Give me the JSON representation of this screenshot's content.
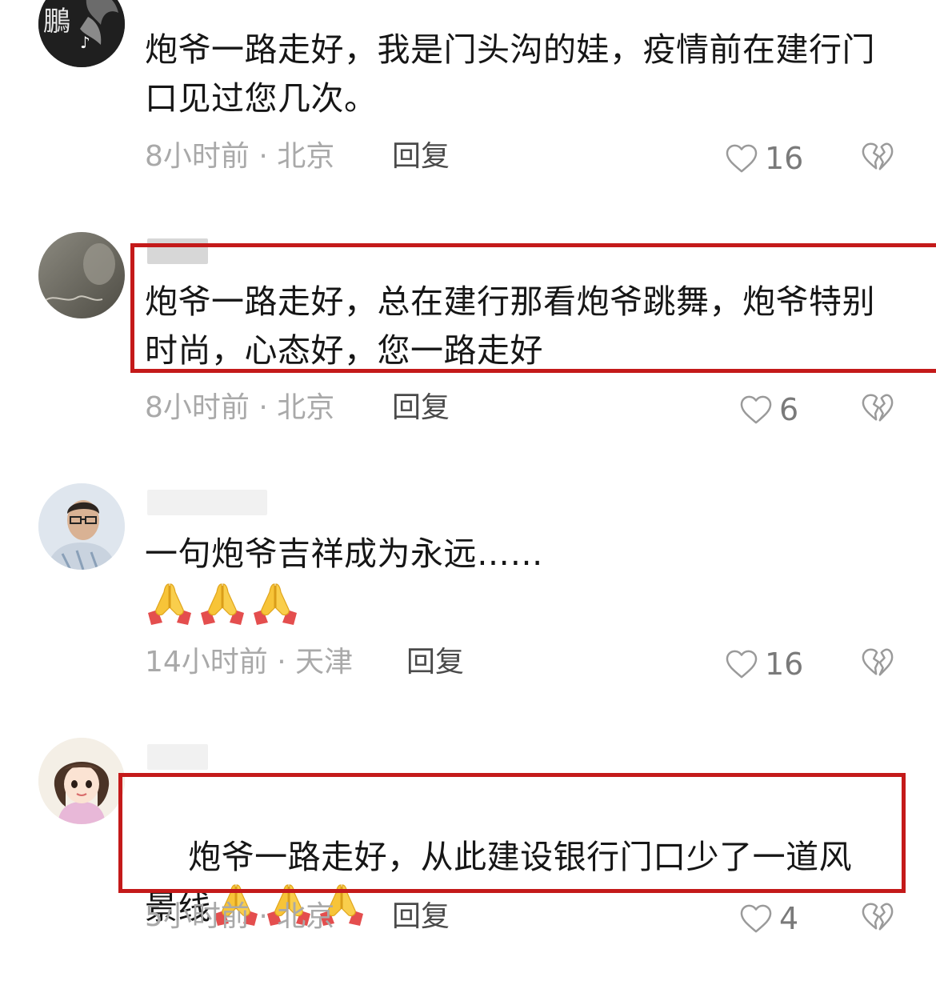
{
  "colors": {
    "highlight": "#c41a1a",
    "meta_text": "#a9a9a9",
    "reply_text": "#4a4a4a",
    "body_text": "#161616"
  },
  "comments": [
    {
      "avatar_icon": "avatar-dark-bird-icon",
      "text": "炮爷一路走好，我是门头沟的娃，疫情前在建行门口见过您几次。",
      "time": "8小时前",
      "location": "北京",
      "reply_label": "回复",
      "likes": "16",
      "highlighted": false
    },
    {
      "avatar_icon": "avatar-gray-photo-icon",
      "text": "炮爷一路走好，总在建行那看炮爷跳舞，炮爷特别时尚，心态好，您一路走好",
      "time": "8小时前",
      "location": "北京",
      "reply_label": "回复",
      "likes": "6",
      "highlighted": true
    },
    {
      "avatar_icon": "avatar-man-glasses-icon",
      "text": "一句炮爷吉祥成为永远……",
      "emoji": [
        "folded-hands-icon",
        "folded-hands-icon",
        "folded-hands-icon"
      ],
      "time": "14小时前",
      "location": "天津",
      "reply_label": "回复",
      "likes": "16",
      "highlighted": false
    },
    {
      "avatar_icon": "avatar-cartoon-girl-icon",
      "text": "炮爷一路走好，从此建设银行门口少了一道风景线",
      "emoji": [
        "folded-hands-icon",
        "folded-hands-icon",
        "folded-hands-icon"
      ],
      "time": "5小时前",
      "location": "北京",
      "reply_label": "回复",
      "likes": "4",
      "highlighted": true
    }
  ],
  "meta_separator": " · "
}
